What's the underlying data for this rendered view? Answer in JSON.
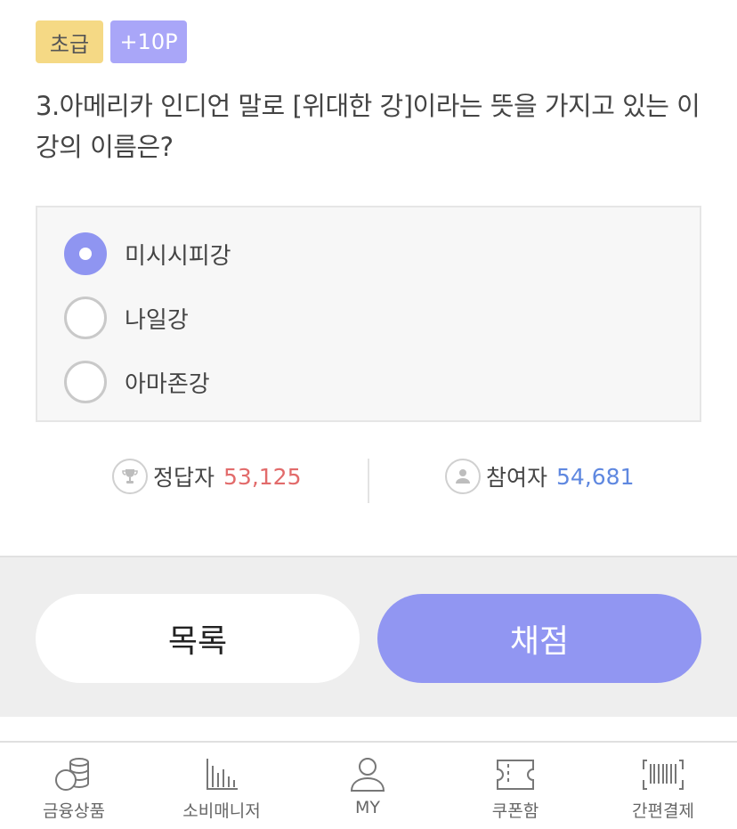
{
  "badges": {
    "level": "초급",
    "points": "+10P"
  },
  "question": {
    "text": "3.아메리카 인디언 말로 [위대한 강]이라는 뜻을 가지고 있는 이 강의 이름은?"
  },
  "options": [
    {
      "label": "미시시피강",
      "selected": true
    },
    {
      "label": "나일강",
      "selected": false
    },
    {
      "label": "아마존강",
      "selected": false
    }
  ],
  "stats": {
    "correct_label": "정답자",
    "correct_count": "53,125",
    "participants_label": "참여자",
    "participants_count": "54,681"
  },
  "actions": {
    "list_label": "목록",
    "grade_label": "채점"
  },
  "tabbar": [
    {
      "label": "금융상품",
      "icon": "coins-icon"
    },
    {
      "label": "소비매니저",
      "icon": "bar-chart-icon"
    },
    {
      "label": "MY",
      "icon": "user-icon"
    },
    {
      "label": "쿠폰함",
      "icon": "ticket-icon"
    },
    {
      "label": "간편결제",
      "icon": "barcode-icon"
    }
  ],
  "colors": {
    "accent": "#9196f2",
    "correct": "#e26b6b",
    "participants": "#5f88e0"
  }
}
